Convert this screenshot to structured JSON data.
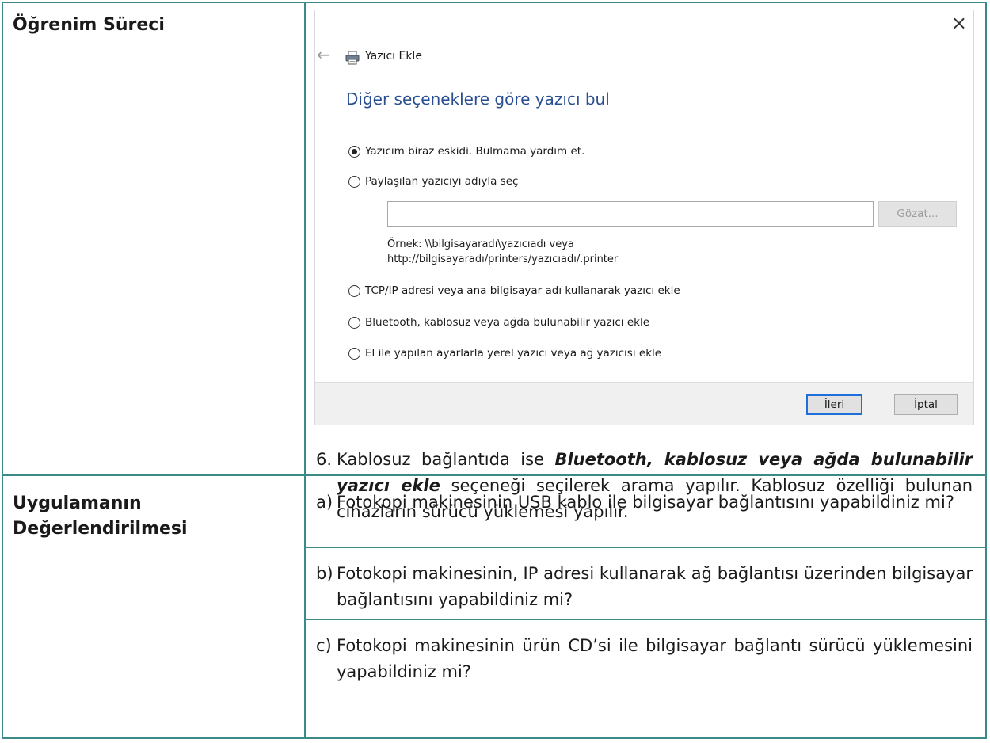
{
  "row1": {
    "label": "Öğrenim Süreci"
  },
  "dialog": {
    "close_glyph": "×",
    "back_glyph": "←",
    "title": "Yazıcı Ekle",
    "heading": "Diğer seçeneklere göre yazıcı bul",
    "options": [
      {
        "label": "Yazıcım biraz eskidi. Bulmama yardım et.",
        "selected": true
      },
      {
        "label": "Paylaşılan yazıcıyı adıyla seç",
        "selected": false
      },
      {
        "label": "TCP/IP adresi veya ana bilgisayar adı kullanarak yazıcı ekle",
        "selected": false
      },
      {
        "label": "Bluetooth, kablosuz veya ağda bulunabilir yazıcı ekle",
        "selected": false
      },
      {
        "label": "El ile yapılan ayarlarla yerel yazıcı veya ağ yazıcısı ekle",
        "selected": false
      }
    ],
    "browse_label": "Gözat...",
    "example_line1": "Örnek: \\\\bilgisayaradı\\yazıcıadı veya",
    "example_line2": "http://bilgisayaradı/printers/yazıcıadı/.printer",
    "next_label": "İleri",
    "cancel_label": "İptal"
  },
  "step6": {
    "marker": "6.",
    "text_before": "Kablosuz bağlantıda ise ",
    "text_bold": "Bluetooth, kablosuz veya ağda bulunabilir yazıcı ekle",
    "text_after": " seçeneği seçilerek arama yapılır. Kablosuz özelliği bulunan cihazların sürücü yüklemesi yapılır."
  },
  "row2": {
    "label_line1": "Uygulamanın",
    "label_line2": "Değerlendirilmesi",
    "items": [
      {
        "marker": "a)",
        "text": "Fotokopi makinesinin USB kablo ile bilgisayar bağlantısını yapabildiniz mi?"
      },
      {
        "marker": "b)",
        "text": "Fotokopi makinesinin, IP adresi kullanarak ağ bağlantısı üzerinden bilgisayar bağlantısını yapabildiniz mi?"
      },
      {
        "marker": "c)",
        "text": "Fotokopi makinesinin ürün CD’si ile bilgisayar bağlantı sürücü yüklemesini yapabildiniz mi?"
      }
    ]
  }
}
